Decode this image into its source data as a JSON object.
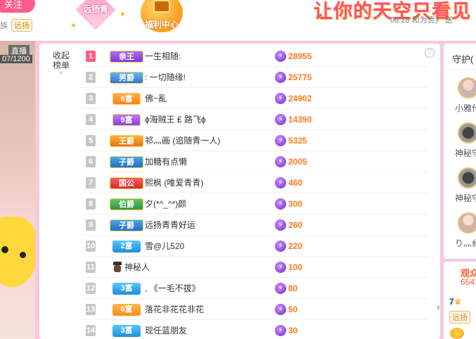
{
  "header": {
    "follow_label": "关注",
    "fans_label": "族",
    "fan_badge": "远扬",
    "gift_label": "远扬青",
    "welfare_label": "福利中心",
    "marquee_text": "让你的天空只看见",
    "marquee_sub": "00:28  和为贵》 送"
  },
  "video": {
    "category_tag": "",
    "live_tag": "直播",
    "viewer_count": "07/1200"
  },
  "rank_panel": {
    "collapse_label_1": "收起",
    "collapse_label_2": "榜单",
    "chevron_glyph": "^",
    "help_glyph": "?",
    "bolt_glyph": "⚡",
    "rows": [
      {
        "rank": "1",
        "badge": "亲王",
        "badge_color": "#7d3ad8",
        "name": "一生相随:",
        "score": "28955"
      },
      {
        "rank": "2",
        "badge": "男爵",
        "badge_color": "#2d75d8",
        "name": ": 一切随缘!",
        "score": "25775"
      },
      {
        "rank": "3",
        "badge": "6富",
        "badge_color": "#ff7d1a",
        "name": "佛~亂",
        "score": "24902"
      },
      {
        "rank": "4",
        "badge": "9富",
        "badge_color": "#8c3ee6",
        "name": "ɸ海贼王 ₤ 路飞ɸ",
        "score": "14390"
      },
      {
        "rank": "5",
        "badge": "王爵",
        "badge_color": "#e8741d",
        "name": "祁灬画 (追随青一人)",
        "score": "5325"
      },
      {
        "rank": "6",
        "badge": "子爵",
        "badge_color": "#1c6ec8",
        "name": "加糖有点懒",
        "score": "2005"
      },
      {
        "rank": "7",
        "badge": "国公",
        "badge_color": "#d62a2a",
        "name": "熙枫 (唯爱青青)",
        "score": "460"
      },
      {
        "rank": "8",
        "badge": "伯爵",
        "badge_color": "#2f9440",
        "name": "夕(*^_^*)颜",
        "score": "300"
      },
      {
        "rank": "9",
        "badge": "子爵",
        "badge_color": "#1c6ec8",
        "name": "远扬青青好运",
        "score": "260"
      },
      {
        "rank": "10",
        "badge": "2富",
        "badge_color": "#1e8edb",
        "name": "雪@儿520",
        "score": "220"
      },
      {
        "rank": "11",
        "badge": "",
        "badge_color": "",
        "name": "神秘人",
        "score": "100"
      },
      {
        "rank": "12",
        "badge": "3富",
        "badge_color": "#1e8edb",
        "name": ", 《一毛不拔》",
        "score": "80"
      },
      {
        "rank": "13",
        "badge": "6富",
        "badge_color": "#ff8a1a",
        "name": "落花非花花非花",
        "score": "50"
      },
      {
        "rank": "14",
        "badge": "3富",
        "badge_color": "#1e8edb",
        "name": "现任蓝朋友",
        "score": "30"
      }
    ]
  },
  "guard_panel": {
    "title": "守护(",
    "items": [
      {
        "name": "小雅什"
      },
      {
        "name": "神秘守"
      },
      {
        "name": "神秘守"
      },
      {
        "name": "り灬纟"
      }
    ]
  },
  "viewers_panel": {
    "title": "观众",
    "count": "6541",
    "level": "7",
    "badge": "远扬",
    "arrow_glyph": "›",
    "crown_glyph": "♛"
  }
}
